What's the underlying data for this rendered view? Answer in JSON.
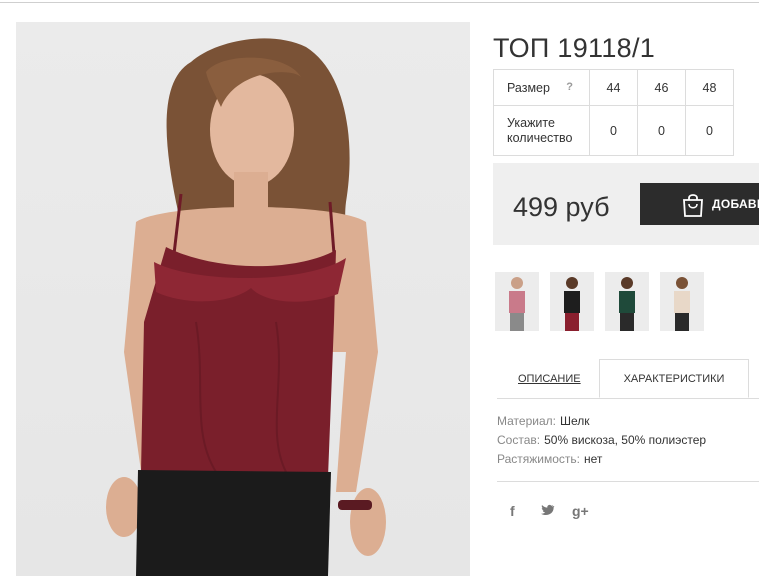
{
  "product": {
    "title": "ТОП 19118/1",
    "price": "499 руб",
    "add_button": "ДОБАВИТЬ"
  },
  "size_table": {
    "size_label": "Размер",
    "help": "?",
    "sizes": [
      "44",
      "46",
      "48"
    ],
    "qty_label_line1": "Укажите",
    "qty_label_line2": "количество",
    "quantities": [
      "0",
      "0",
      "0"
    ]
  },
  "tabs": {
    "description": "ОПИСАНИЕ",
    "characteristics": "ХАРАКТЕРИСТИКИ"
  },
  "specs": [
    {
      "key": "Материал:",
      "value": "Шелк"
    },
    {
      "key": "Состав:",
      "value": "50% вискоза, 50% полиэстер"
    },
    {
      "key": "Растяжимость:",
      "value": "нет"
    }
  ],
  "social": {
    "facebook": "f",
    "twitter": "🐦",
    "googleplus": "g+"
  },
  "thumbnails": [
    {
      "top_color": "#c97a8a",
      "pants_color": "#8a8a8a"
    },
    {
      "top_color": "#1e1e1e",
      "pants_color": "#8a1f2e"
    },
    {
      "top_color": "#1f4a3a",
      "pants_color": "#2a2a2a"
    },
    {
      "top_color": "#e8d8c8",
      "pants_color": "#2a2a2a"
    }
  ],
  "colors": {
    "burgundy": "#7a1f2b",
    "button_bg": "#2c2c2c",
    "price_bg": "#efefef"
  }
}
